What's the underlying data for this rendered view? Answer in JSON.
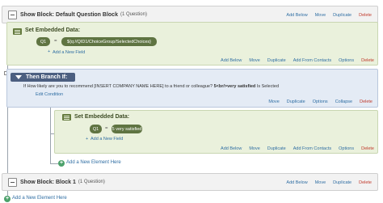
{
  "block1": {
    "title": "Show Block: Default Question Block",
    "count": "(1 Question)",
    "actions": [
      "Add Below",
      "Move",
      "Duplicate",
      "Delete"
    ]
  },
  "embed1": {
    "title": "Set Embedded Data:",
    "field_name": "Q1",
    "equals": "=",
    "value": "${q://QID1/ChoiceGroup/SelectedChoices}",
    "add_field": "Add a New Field",
    "actions": [
      "Add Below",
      "Move",
      "Duplicate",
      "Add From Contacts",
      "Options",
      "Delete"
    ]
  },
  "branch": {
    "title": "Then Branch If:",
    "condition_prefix": "If",
    "condition_question": "How likely are you to recommend [INSERT COMPANY NAME HERE] to a friend or colleague?",
    "condition_value": "5<br/>very satisfied",
    "condition_suffix": "Is Selected",
    "edit_condition": "Edit Condition",
    "actions": [
      "Move",
      "Duplicate",
      "Options",
      "Collapse",
      "Delete"
    ]
  },
  "embed2": {
    "title": "Set Embedded Data:",
    "field_name": "Q1",
    "equals": "=",
    "value": "5 very satisfied",
    "add_field": "Add a New Field",
    "actions": [
      "Add Below",
      "Move",
      "Duplicate",
      "Add From Contacts",
      "Options",
      "Delete"
    ]
  },
  "add_element_inner": "Add a New Element Here",
  "block2": {
    "title": "Show Block: Block 1",
    "count": "(1 Question)",
    "actions": [
      "Add Below",
      "Move",
      "Duplicate",
      "Delete"
    ]
  },
  "add_element_bottom": "Add a New Element Here",
  "colors": {
    "embed_bg": "#eaf1dc",
    "branch_bg": "#e4ebf5",
    "link": "#2f6ea3",
    "delete": "#c0392b",
    "pill": "#5f7442"
  }
}
